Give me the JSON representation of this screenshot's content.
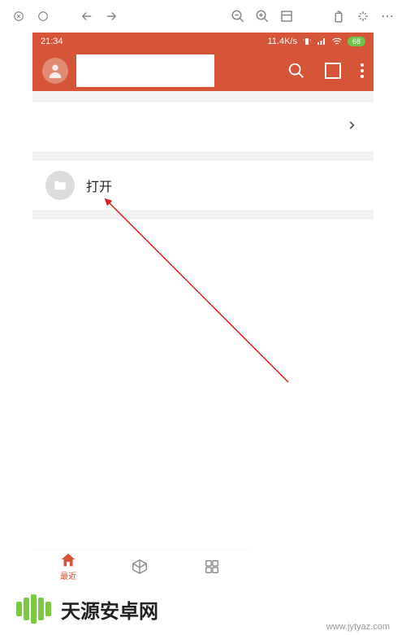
{
  "status": {
    "time": "21:34",
    "network": "11.4K/s",
    "battery": "68"
  },
  "menu": {
    "open_label": "打开"
  },
  "bottom_nav": {
    "recent_label": "最近"
  },
  "footer": {
    "title": "天源安卓网",
    "url": "www.jytyaz.com"
  }
}
